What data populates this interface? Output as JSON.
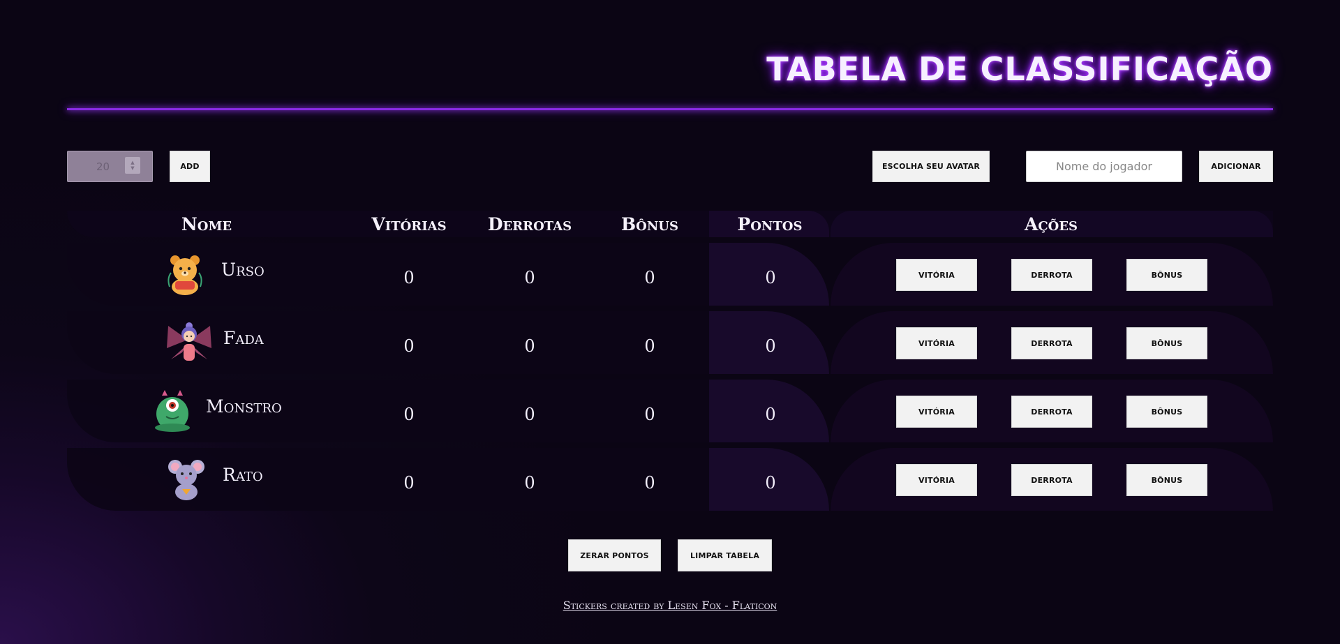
{
  "header": {
    "title": "Tabela de Classificação"
  },
  "toolbar": {
    "number_value": "20",
    "add_label": "ADD",
    "avatar_label": "Escolha seu avatar",
    "name_placeholder": "Nome do jogador",
    "adicionar_label": "Adicionar"
  },
  "table": {
    "columns": [
      "Nome",
      "Vitórias",
      "Derrotas",
      "Bônus",
      "Pontos",
      "Ações"
    ],
    "rows": [
      {
        "name": "Urso",
        "avatar": "bear-avatar-icon",
        "vitorias": "0",
        "derrotas": "0",
        "bonus": "0",
        "pontos": "0"
      },
      {
        "name": "Fada",
        "avatar": "fairy-avatar-icon",
        "vitorias": "0",
        "derrotas": "0",
        "bonus": "0",
        "pontos": "0"
      },
      {
        "name": "Monstro",
        "avatar": "monster-avatar-icon",
        "vitorias": "0",
        "derrotas": "0",
        "bonus": "0",
        "pontos": "0"
      },
      {
        "name": "Rato",
        "avatar": "mouse-avatar-icon",
        "vitorias": "0",
        "derrotas": "0",
        "bonus": "0",
        "pontos": "0"
      }
    ],
    "actions": {
      "vitoria": "Vitória",
      "derrota": "Derrota",
      "bonus": "Bônus"
    }
  },
  "footer": {
    "zerar_label": "Zerar pontos",
    "limpar_label": "Limpar tabela",
    "credit": "Stickers created by Lesen Fox - Flaticon"
  },
  "colors": {
    "accent": "#8a2be2",
    "button_bg": "#f2f2f2",
    "bg": "#0d0618"
  }
}
